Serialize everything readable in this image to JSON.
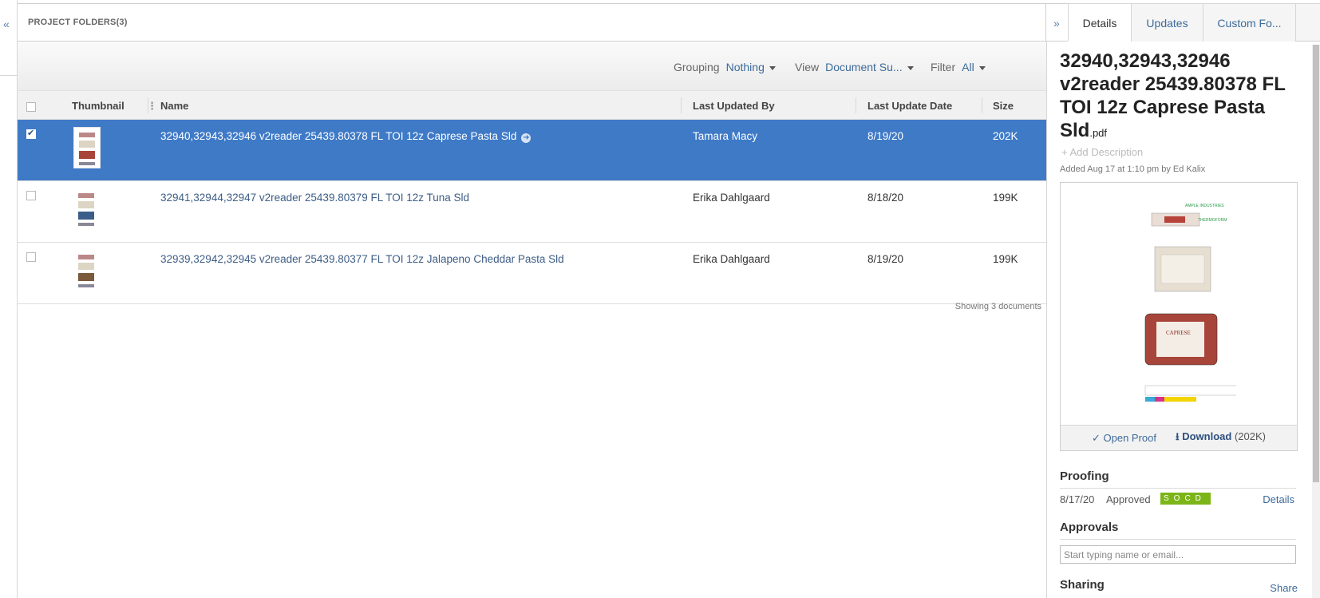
{
  "left_rail": {
    "collapse_icon": "«"
  },
  "folder_header": {
    "title": "PROJECT FOLDERS(3)"
  },
  "toolbar": {
    "grouping_label": "Grouping",
    "grouping_value": "Nothing",
    "view_label": "View",
    "view_value": "Document Su...",
    "filter_label": "Filter",
    "filter_value": "All"
  },
  "table": {
    "columns": {
      "thumbnail": "Thumbnail",
      "name": "Name",
      "updated_by": "Last Updated By",
      "update_date": "Last Update Date",
      "size": "Size"
    },
    "rows": [
      {
        "name": "32940,32943,32946 v2reader 25439.80378 FL TOI 12z Caprese Pasta Sld",
        "updated_by": "Tamara Macy",
        "date": "8/19/20",
        "size": "202K",
        "selected": true
      },
      {
        "name": "32941,32944,32947 v2reader 25439.80379 FL TOI 12z Tuna Sld",
        "updated_by": "Erika Dahlgaard",
        "date": "8/18/20",
        "size": "199K",
        "selected": false
      },
      {
        "name": "32939,32942,32945 v2reader 25439.80377 FL TOI 12z Jalapeno Cheddar Pasta Sld",
        "updated_by": "Erika Dahlgaard",
        "date": "8/19/20",
        "size": "199K",
        "selected": false
      }
    ],
    "showing": "Showing 3 documents"
  },
  "right_panel": {
    "expand_icon": "»",
    "tabs": {
      "details": "Details",
      "updates": "Updates",
      "custom": "Custom Fo..."
    },
    "doc_title": "32940,32943,32946 v2reader 25439.80378 FL TOI 12z Caprese Pasta Sld",
    "doc_ext": ".pdf",
    "add_description": "+ Add Description",
    "added": "Added Aug 17 at 1:10 pm by Ed Kalix",
    "open_proof": "✓ Open Proof",
    "download": "Download",
    "download_size": "(202K)",
    "proofing": {
      "heading": "Proofing",
      "date": "8/17/20",
      "status": "Approved",
      "badge": "SOCD",
      "details": "Details"
    },
    "approvals": {
      "heading": "Approvals",
      "placeholder": "Start typing name or email..."
    },
    "sharing": {
      "heading": "Sharing",
      "share": "Share"
    }
  },
  "colors": {
    "selected_row": "#3f7ac7",
    "link": "#3d6a99",
    "approved_badge": "#7cb518"
  }
}
